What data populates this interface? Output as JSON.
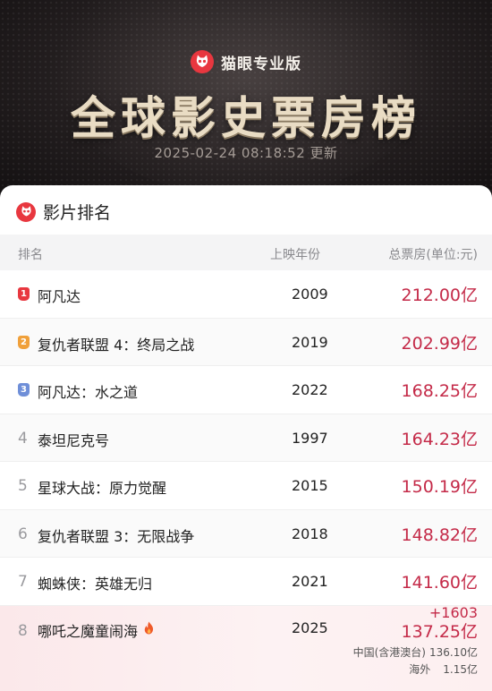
{
  "brand": {
    "name": "猫眼专业版"
  },
  "title": "全球影史票房榜",
  "update_time": "2025-02-24 08:18:52 更新",
  "section_title": "影片排名",
  "columns": {
    "rank": "排名",
    "year": "上映年份",
    "box_office": "总票房(单位:元)"
  },
  "rank_colors": {
    "1": "#e8373f",
    "2": "#f0a03a",
    "3": "#6f8fd8"
  },
  "movies": [
    {
      "rank": "1",
      "title": "阿凡达",
      "year": "2009",
      "box": "212.00亿"
    },
    {
      "rank": "2",
      "title": "复仇者联盟 4：终局之战",
      "year": "2019",
      "box": "202.99亿"
    },
    {
      "rank": "3",
      "title": "阿凡达：水之道",
      "year": "2022",
      "box": "168.25亿"
    },
    {
      "rank": "4",
      "title": "泰坦尼克号",
      "year": "1997",
      "box": "164.23亿"
    },
    {
      "rank": "5",
      "title": "星球大战：原力觉醒",
      "year": "2015",
      "box": "150.19亿"
    },
    {
      "rank": "6",
      "title": "复仇者联盟 3：无限战争",
      "year": "2018",
      "box": "148.82亿"
    },
    {
      "rank": "7",
      "title": "蜘蛛侠：英雄无归",
      "year": "2021",
      "box": "141.60亿"
    },
    {
      "rank": "8",
      "title": "哪吒之魔童闹海",
      "year": "2025",
      "box": "137.25亿",
      "increase": "+1603",
      "breakdown": [
        {
          "label": "中国(含港澳台)",
          "value": "136.10亿"
        },
        {
          "label": "海外",
          "value": "1.15亿"
        }
      ]
    }
  ]
}
